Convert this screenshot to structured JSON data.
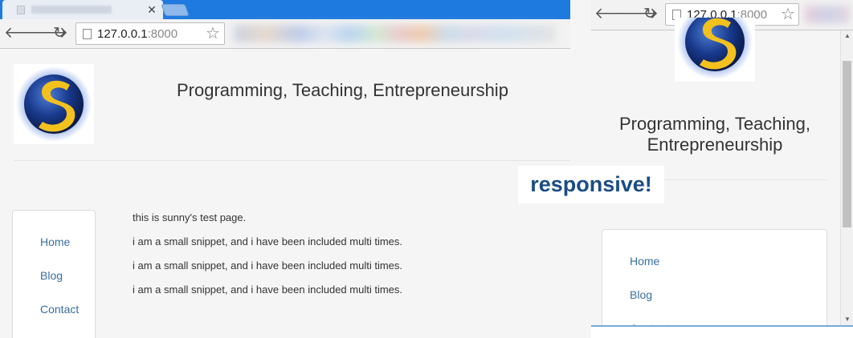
{
  "left_browser": {
    "toolbar": {
      "url_host": "127.0.0.1",
      "url_port": ":8000"
    }
  },
  "site": {
    "title": "Programming, Teaching, Entrepreneurship",
    "nav": [
      "Home",
      "Blog",
      "Contact"
    ],
    "content": [
      "this is sunny's test page.",
      "i am a small snippet, and i have been included multi times.",
      "i am a small snippet, and i have been included multi times.",
      "i am a small snippet, and i have been included multi times."
    ]
  },
  "right_browser": {
    "toolbar": {
      "url_host": "127.0.0.1",
      "url_port": ":8000"
    },
    "title_line1": "Programming, Teaching,",
    "title_line2": "Entrepreneurship"
  },
  "overlay_label": "responsive!",
  "colors": {
    "tabstrip": "#1f7adf",
    "link": "#3a6fa1",
    "overlay_text": "#1b4c85"
  }
}
